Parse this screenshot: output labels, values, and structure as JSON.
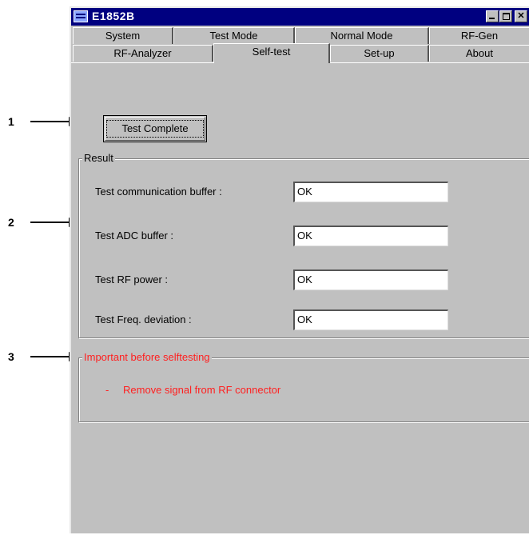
{
  "callouts": [
    "1",
    "2",
    "3"
  ],
  "window": {
    "title": "E1852B",
    "controls": {
      "minimize": "",
      "maximize": "",
      "close": "✕"
    }
  },
  "tabs": {
    "row1": [
      "System",
      "Test Mode",
      "Normal Mode",
      "RF-Gen"
    ],
    "row2": [
      "RF-Analyzer",
      "Self-test",
      "Set-up",
      "About"
    ],
    "active": "Self-test"
  },
  "button": {
    "label": "Test Complete"
  },
  "result": {
    "legend": "Result",
    "rows": [
      {
        "label": "Test communication buffer :",
        "value": "OK"
      },
      {
        "label": "Test ADC buffer :",
        "value": "OK"
      },
      {
        "label": "Test RF power :",
        "value": "OK"
      },
      {
        "label": "Test Freq. deviation :",
        "value": "OK"
      }
    ]
  },
  "important": {
    "legend": "Important before selftesting",
    "bullet": "-",
    "note": "Remove signal from RF connector"
  },
  "colors": {
    "title_bar": "#000080",
    "warning_text": "#ff2020",
    "face": "#c0c0c0"
  }
}
